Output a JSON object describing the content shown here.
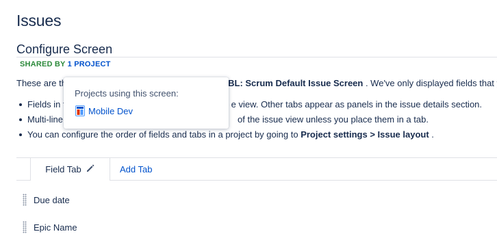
{
  "header": {
    "title": "Issues"
  },
  "screen": {
    "title": "Configure Screen",
    "shared_by_prefix": "SHARED BY",
    "shared_by_link": "1 PROJECT",
    "intro_start": "These are th",
    "intro_bold": "OBL: Scrum Default Issue Screen",
    "intro_end": " . We've only displayed fields that y"
  },
  "bullets": [
    {
      "text": "Fields in t",
      "tail": "e view. Other tabs appear as panels in the issue details section."
    },
    {
      "text": "Multi-line",
      "tail": "of the issue view unless you place them in a tab."
    },
    {
      "text_start": "You can configure the order of fields and tabs in a project by going to ",
      "bold": "Project settings > Issue layout",
      "text_end": " ."
    }
  ],
  "tabs": {
    "active_label": "Field Tab",
    "add_label": "Add Tab"
  },
  "fields": [
    {
      "label": "Due date"
    },
    {
      "label": "Epic Name"
    }
  ],
  "popup": {
    "title": "Projects using this screen:",
    "projects": [
      {
        "name": "Mobile Dev",
        "icon": "project-avatar-icon"
      }
    ]
  },
  "colors": {
    "text": "#172b4d",
    "link": "#0052cc",
    "shared_green": "#2c8a3b",
    "divider": "#dfe1e6"
  }
}
